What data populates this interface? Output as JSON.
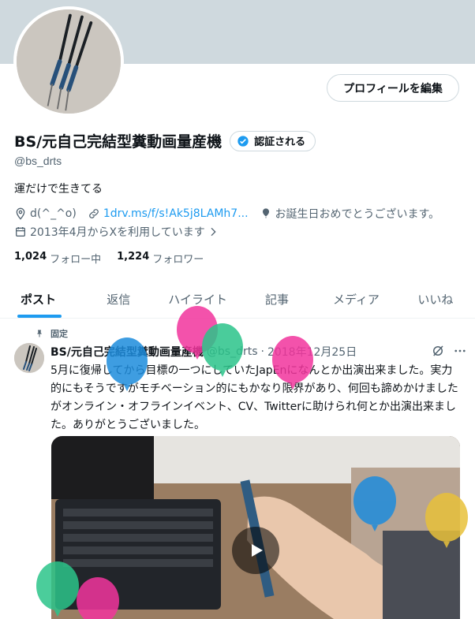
{
  "profile": {
    "display_name": "BS/元自己完結型糞動画量産機",
    "verify_label": "認証される",
    "handle": "@bs_drts",
    "bio": "運だけで生きてる",
    "location": "d(^_^o)",
    "url": "1drv.ms/f/s!Ak5j8LAMh7...",
    "birthday": "お誕生日おめでとうございます。",
    "joined": "2013年4月からXを利用しています",
    "following_count": "1,024",
    "following_label": "フォロー中",
    "followers_count": "1,224",
    "followers_label": "フォロワー"
  },
  "edit_button": "プロフィールを編集",
  "tabs": [
    {
      "label": "ポスト"
    },
    {
      "label": "返信"
    },
    {
      "label": "ハイライト"
    },
    {
      "label": "記事"
    },
    {
      "label": "メディア"
    },
    {
      "label": "いいね"
    }
  ],
  "post": {
    "pinned_label": "固定",
    "name": "BS/元自己完結型糞動画量産機",
    "handle": "@bs_drts",
    "date": "2018年12月25日",
    "text": "5月に復帰してから目標の一つにしていたJapEnになんとか出演出来ました。実力的にもそうですがモチベーション的にもかなり限界があり、何回も諦めかけましたがオンライン・オフラインイベント、CV、Twitterに助けられ何とか出演出来ました。ありがとうございました。"
  },
  "colors": {
    "accent": "#1d9bf0",
    "balloon_pink": "#f2359d",
    "balloon_green": "#2bc48a",
    "balloon_blue": "#1d8cdc",
    "balloon_yellow": "#e8c13a"
  },
  "icons": [
    "location-icon",
    "link-icon",
    "balloon-icon",
    "calendar-icon",
    "chevron-right-icon",
    "verified-icon",
    "pin-icon",
    "grok-icon",
    "more-icon",
    "play-icon"
  ]
}
